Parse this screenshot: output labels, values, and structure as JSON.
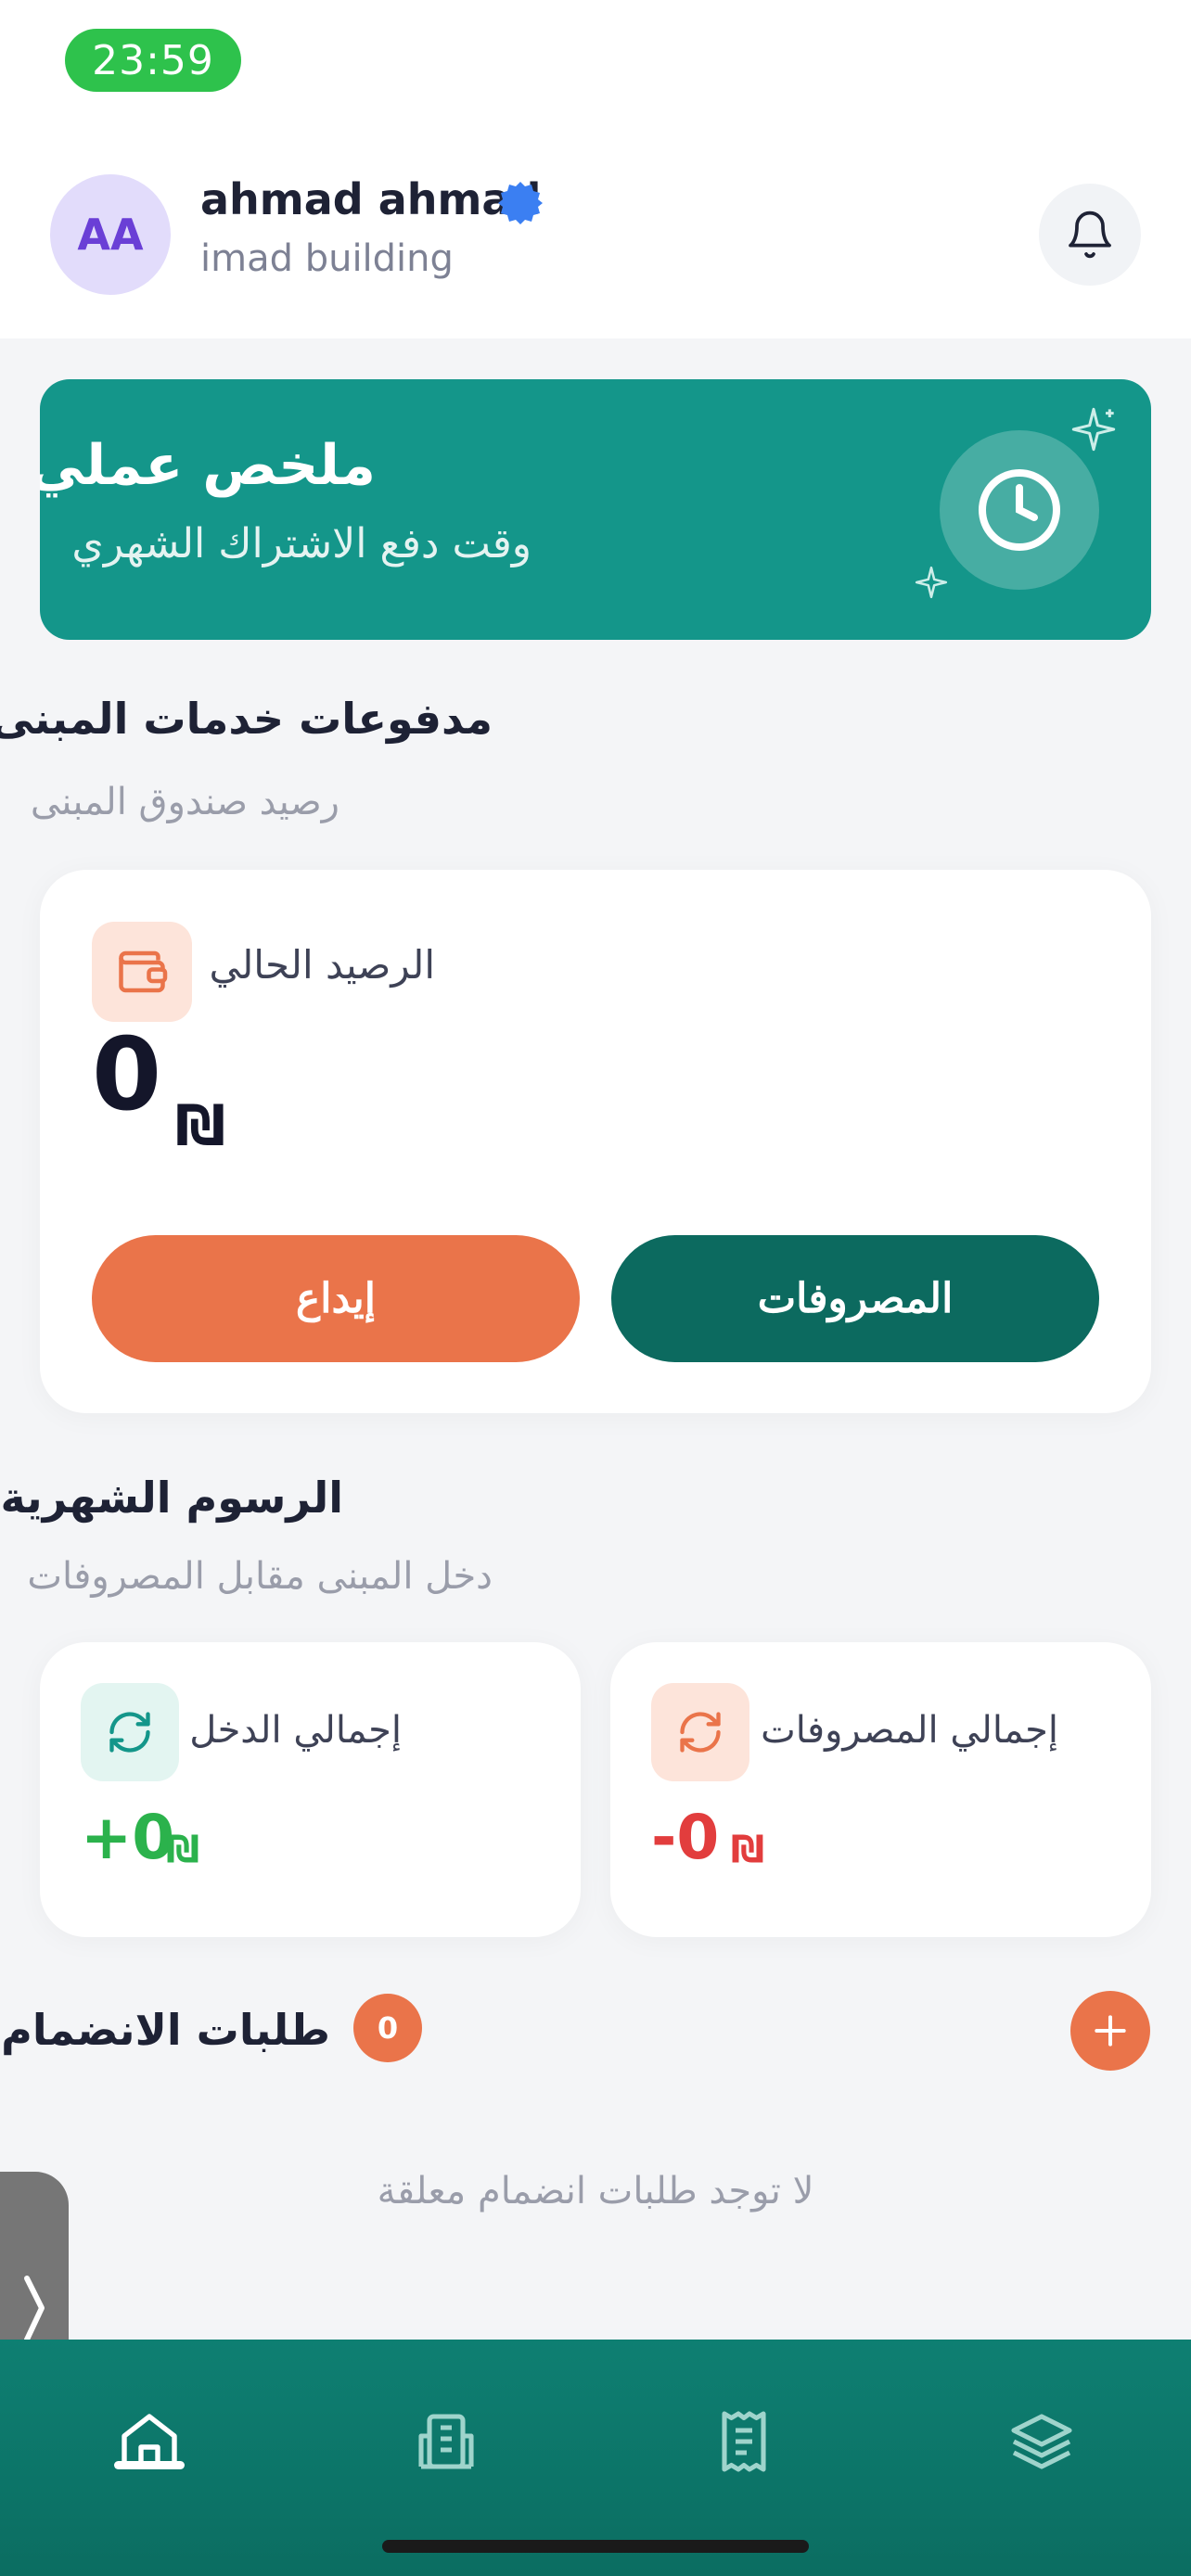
{
  "status_bar": {
    "time": "23:59"
  },
  "header": {
    "avatar_initials": "AA",
    "user_name": "ahmad ahmad",
    "building_name": "imad building"
  },
  "summary": {
    "title": "ملخص عملي",
    "subtitle": "وقت دفع الاشتراك الشهري"
  },
  "payments": {
    "title": "مدفوعات خدمات المبنى",
    "subtitle": "رصيد صندوق المبنى",
    "balance_label": "الرصيد الحالي",
    "balance_value": "0",
    "currency": "₪",
    "expenses_button": "المصروفات",
    "deposit_button": "إيداع"
  },
  "monthly_fees": {
    "title": "الرسوم الشهرية",
    "subtitle": "دخل المبنى مقابل المصروفات",
    "income": {
      "label": "إجمالي الدخل",
      "value": "+0",
      "currency": "₪"
    },
    "expenses": {
      "label": "إجمالي المصروفات",
      "value": "-0",
      "currency": "₪"
    }
  },
  "join_requests": {
    "title": "طلبات الانضمام",
    "count": "0",
    "empty_text": "لا توجد طلبات انضمام معلقة"
  },
  "colors": {
    "primary_teal": "#14968a",
    "dark_teal": "#0c6a5f",
    "accent_orange": "#ea744a",
    "income_green": "#2bb24c",
    "expense_red": "#e23d3d"
  },
  "nav": {
    "items": [
      "home-icon",
      "building-icon",
      "receipt-icon",
      "layers-icon"
    ],
    "active": "home-icon"
  }
}
